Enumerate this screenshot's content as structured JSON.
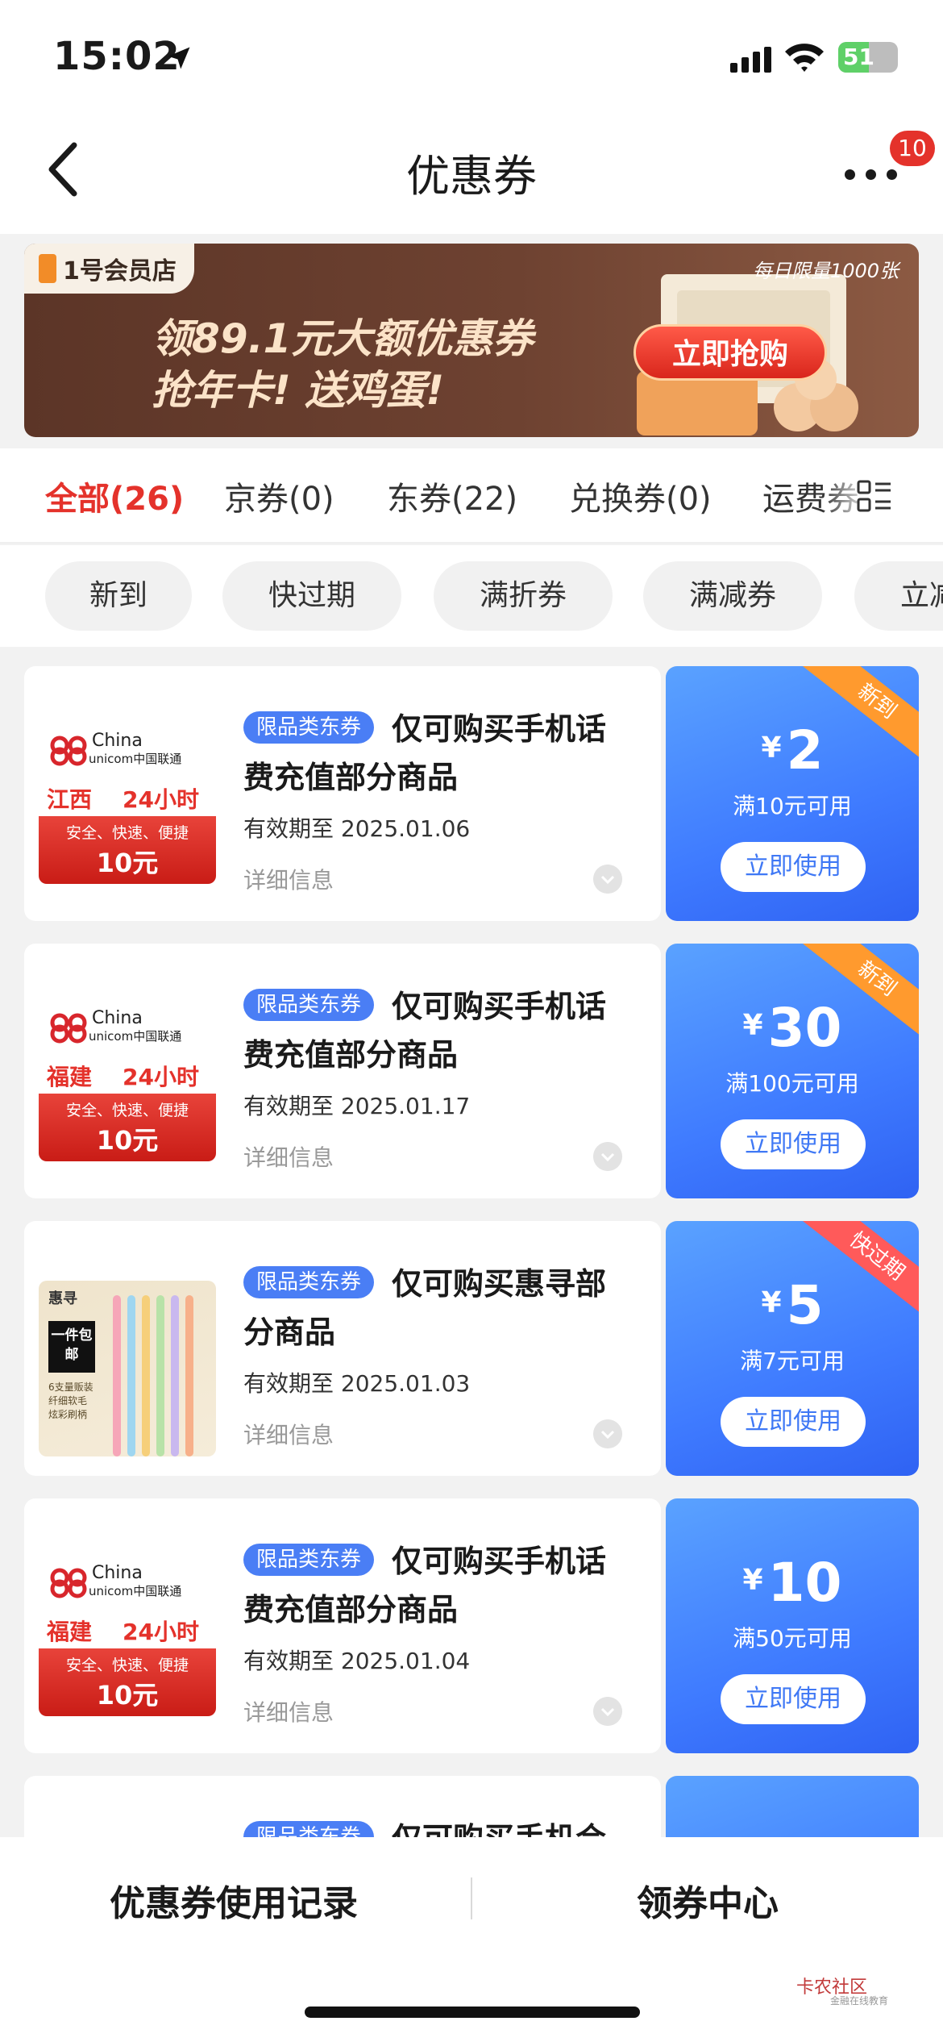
{
  "status_bar": {
    "time": "15:02",
    "battery": "51",
    "battery_level": 0.51
  },
  "nav": {
    "title": "优惠券",
    "badge": "10"
  },
  "banner": {
    "logo": "1号会员店",
    "line1": "领89.1元大额优惠券",
    "line2": "抢年卡! 送鸡蛋!",
    "limit": "每日限量1000张",
    "cta": "立即抢购"
  },
  "tabs": [
    "全部(26)",
    "京券(0)",
    "东券(22)",
    "兑换券(0)",
    "运费券"
  ],
  "chips": [
    "新到",
    "快过期",
    "满折券",
    "满减券",
    "立减券"
  ],
  "coupons": [
    {
      "tag": "限品类东券",
      "title": "仅可购买手机话费充值部分商品",
      "expiry": "有效期至 2025.01.06",
      "detail": "详细信息",
      "symbol": "¥",
      "amount": "2",
      "threshold": "满10元可用",
      "button": "立即使用",
      "ribbon": "新到",
      "img": {
        "china": "China",
        "unicom": "unicom中国联通",
        "region": "江西",
        "hours": "24小时",
        "slogan": "安全、快速、便捷",
        "value": "10元"
      }
    },
    {
      "tag": "限品类东券",
      "title": "仅可购买手机话费充值部分商品",
      "expiry": "有效期至 2025.01.17",
      "detail": "详细信息",
      "symbol": "¥",
      "amount": "30",
      "threshold": "满100元可用",
      "button": "立即使用",
      "ribbon": "新到",
      "img": {
        "china": "China",
        "unicom": "unicom中国联通",
        "region": "福建",
        "hours": "24小时",
        "slogan": "安全、快速、便捷",
        "value": "10元"
      }
    },
    {
      "tag": "限品类东券",
      "title": "仅可购买惠寻部分商品",
      "expiry": "有效期至 2025.01.03",
      "detail": "详细信息",
      "symbol": "¥",
      "amount": "5",
      "threshold": "满7元可用",
      "button": "立即使用",
      "ribbon": "快过期",
      "img": {
        "brand": "惠寻",
        "box": "一件包邮",
        "sub1": "6支量贩装",
        "sub2": "纤细软毛",
        "sub3": "炫彩刷柄"
      }
    },
    {
      "tag": "限品类东券",
      "title": "仅可购买手机话费充值部分商品",
      "expiry": "有效期至 2025.01.04",
      "detail": "详细信息",
      "symbol": "¥",
      "amount": "10",
      "threshold": "满50元可用",
      "button": "立即使用",
      "img": {
        "china": "China",
        "unicom": "unicom中国联通",
        "region": "福建",
        "hours": "24小时",
        "slogan": "安全、快速、便捷",
        "value": "10元"
      }
    },
    {
      "tag": "限品类东券",
      "title": "仅可购买手机合"
    }
  ],
  "bottom": {
    "history": "优惠券使用记录",
    "center": "领券中心"
  },
  "watermark": {
    "name": "卡农社区",
    "sub": "金融在线教育"
  },
  "colors": {
    "accent_red": "#e4322b",
    "coupon_blue": "#3f7bff",
    "tag_blue": "#4a7ef5",
    "ribbon_orange": "#ff9a2e"
  }
}
